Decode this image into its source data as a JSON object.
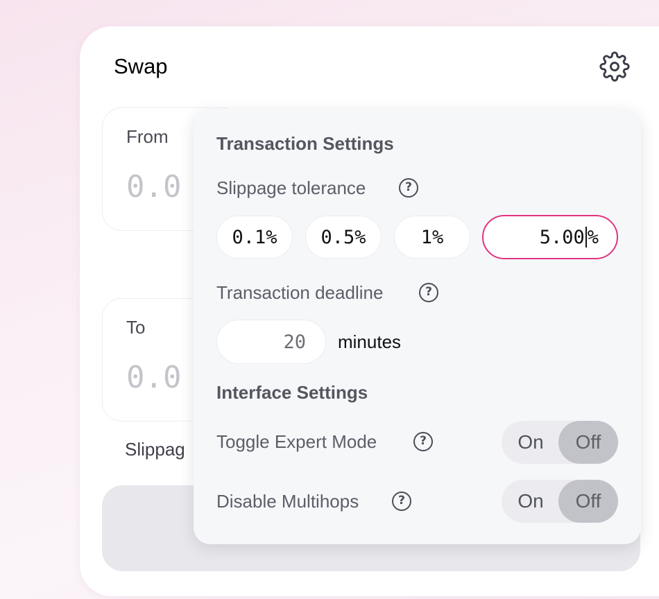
{
  "swap": {
    "title": "Swap",
    "from": {
      "label": "From",
      "amount_placeholder": "0.0"
    },
    "to": {
      "label": "To",
      "amount_placeholder": "0.0"
    },
    "slippage_label_partial": "Slippag"
  },
  "settings": {
    "transaction_heading": "Transaction Settings",
    "slippage_label": "Slippage tolerance",
    "slippage_options": [
      "0.1%",
      "0.5%",
      "1%"
    ],
    "slippage_custom_value": "5.00",
    "slippage_custom_suffix": "%",
    "deadline_label": "Transaction deadline",
    "deadline_value": "20",
    "deadline_unit": "minutes",
    "interface_heading": "Interface Settings",
    "expert_mode_label": "Toggle Expert Mode",
    "multihops_label": "Disable Multihops",
    "toggle_on": "On",
    "toggle_off": "Off",
    "help_glyph": "?"
  },
  "colors": {
    "accent": "#e0337f",
    "toggle_selected": "#c2c3c9"
  },
  "icons": [
    "gear-icon",
    "help-icon"
  ]
}
